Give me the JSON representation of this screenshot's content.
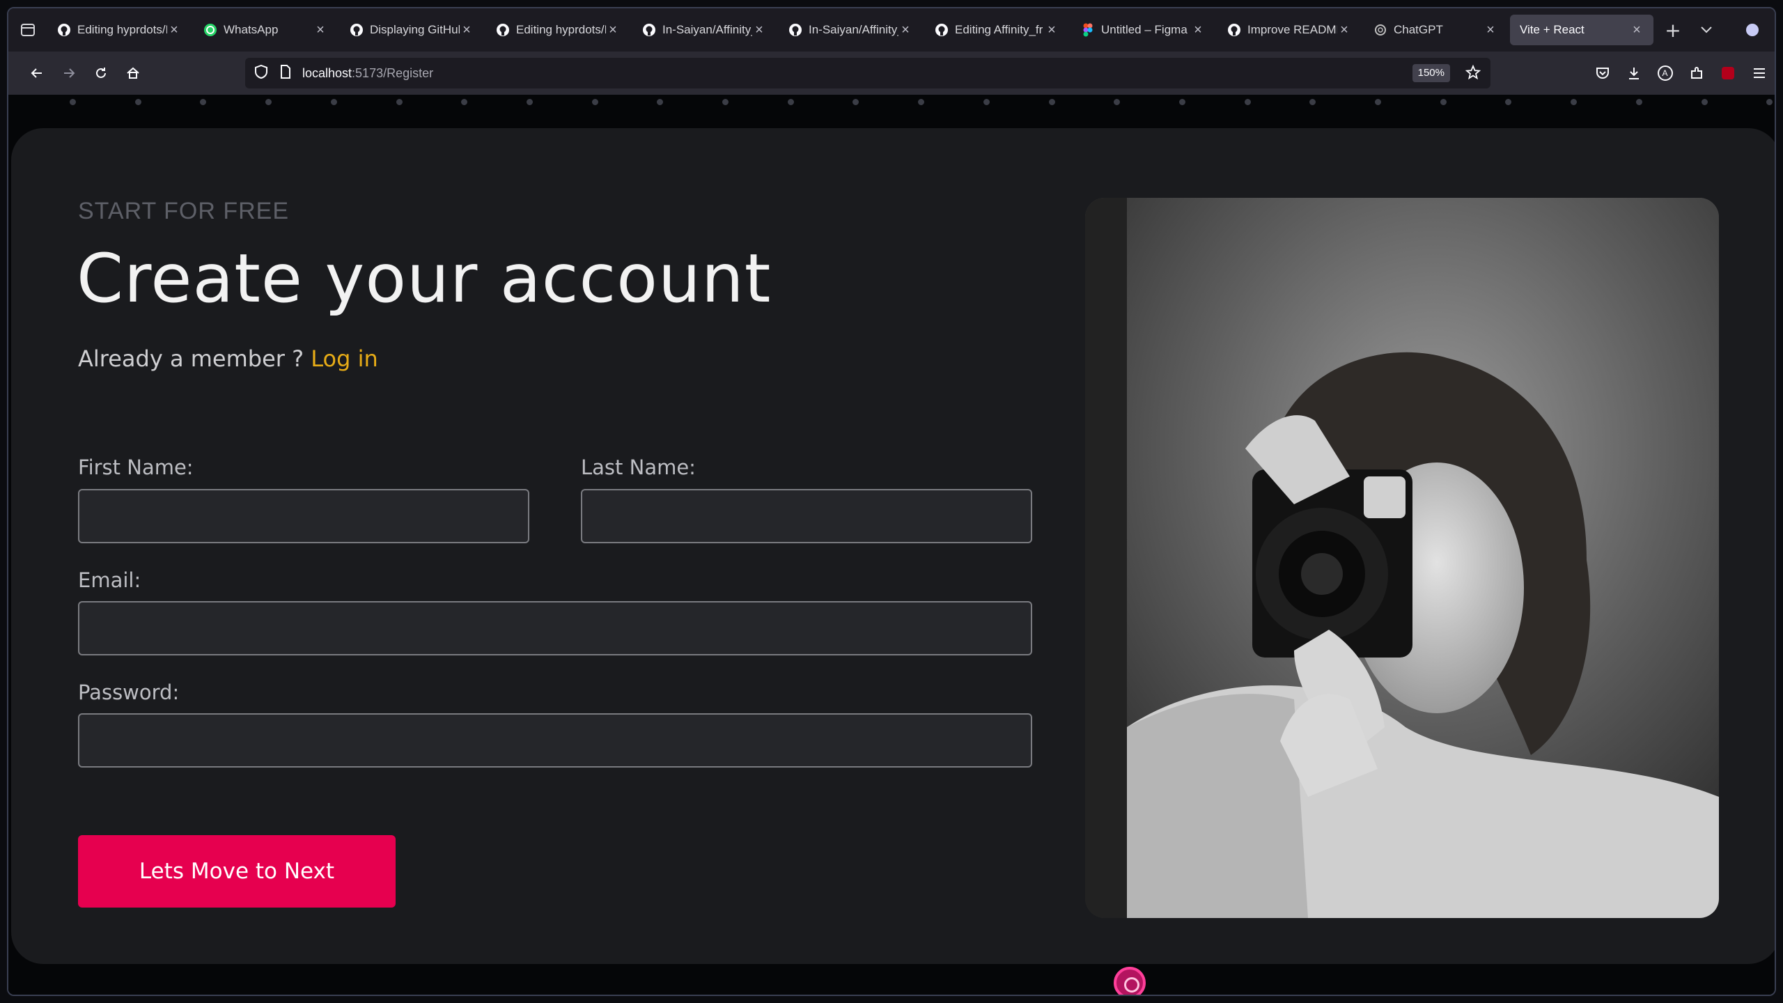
{
  "browser": {
    "tabs": [
      {
        "title": "Editing hyprdots/R",
        "icon": "github-icon",
        "active": false
      },
      {
        "title": "WhatsApp",
        "icon": "whatsapp-icon",
        "active": false
      },
      {
        "title": "Displaying GitHub",
        "icon": "github-icon",
        "active": false
      },
      {
        "title": "Editing hyprdots/R",
        "icon": "github-icon",
        "active": false
      },
      {
        "title": "In-Saiyan/Affinity_",
        "icon": "github-icon",
        "active": false
      },
      {
        "title": "In-Saiyan/Affinity_",
        "icon": "github-icon",
        "active": false
      },
      {
        "title": "Editing Affinity_fr",
        "icon": "github-icon",
        "active": false
      },
      {
        "title": "Untitled – Figma",
        "icon": "figma-icon",
        "active": false
      },
      {
        "title": "Improve README",
        "icon": "github-icon",
        "active": false
      },
      {
        "title": "ChatGPT",
        "icon": "chatgpt-icon",
        "active": false
      },
      {
        "title": "Vite + React",
        "icon": "",
        "active": true
      }
    ],
    "new_tab": "+",
    "url_host": "localhost",
    "url_path": ":5173/Register",
    "zoom": "150%"
  },
  "page": {
    "eyebrow": "START FOR FREE",
    "title": "Create your account",
    "member_prompt": "Already a member ? ",
    "login_link": "Log in",
    "form": {
      "first_name_label": "First Name:",
      "first_name_value": "",
      "last_name_label": "Last Name:",
      "last_name_value": "",
      "email_label": "Email:",
      "email_value": "",
      "password_label": "Password:",
      "password_value": ""
    },
    "submit_label": "Lets Move to Next"
  },
  "colors": {
    "accent_button": "#e6004f",
    "login_link": "#e7ac17",
    "card_bg": "#1a1b1e"
  }
}
